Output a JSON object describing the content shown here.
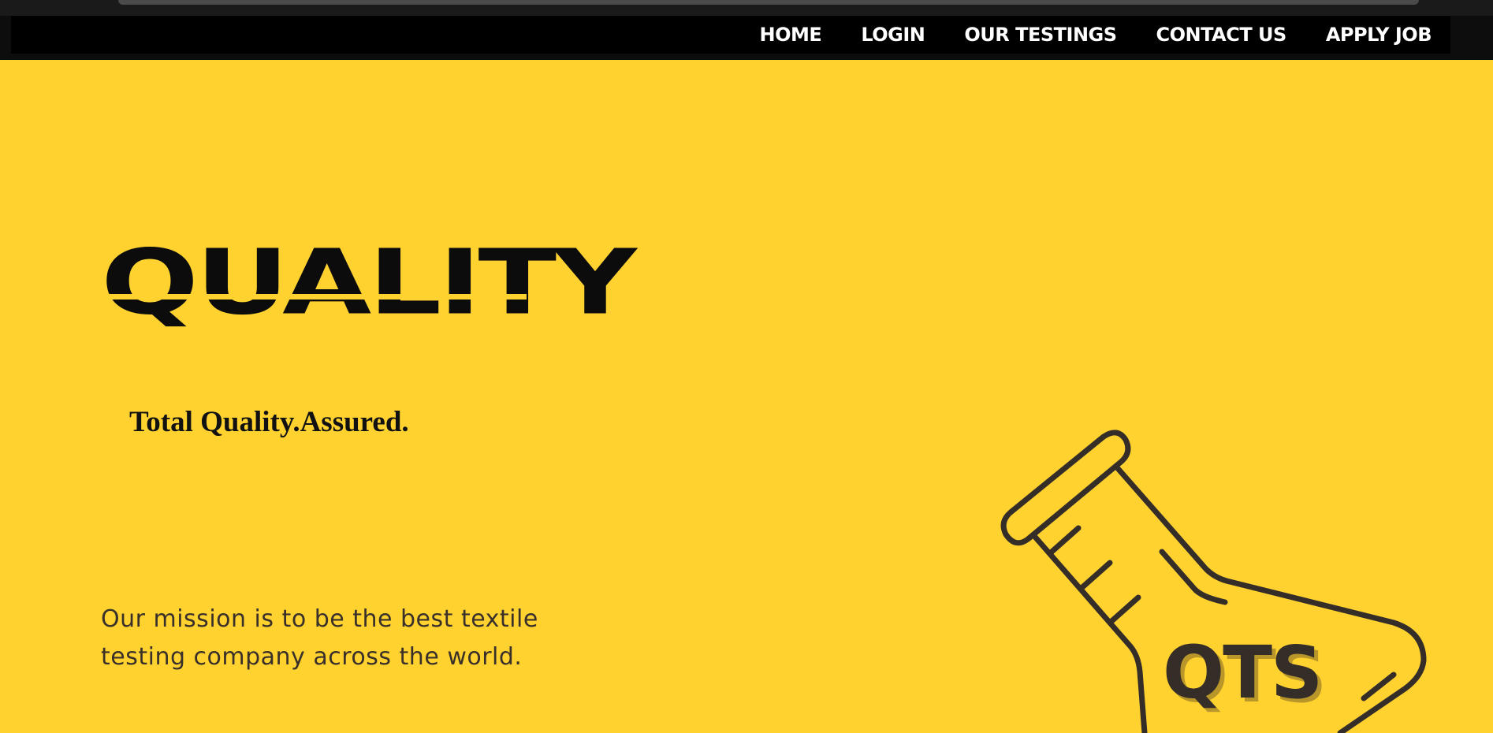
{
  "nav": {
    "items": [
      "HOME",
      "LOGIN",
      "OUR TESTINGS",
      "CONTACT US",
      "APPLY JOB"
    ]
  },
  "hero": {
    "title": "QUALITY",
    "tagline": "Total Quality.Assured.",
    "mission_line1": "Our mission is to be the best textile",
    "mission_line2": "testing company across the world."
  },
  "logo": {
    "text": "QTS",
    "icon": "flask-icon"
  },
  "colors": {
    "background": "#ffd230",
    "navbar": "#000000",
    "nav_text": "#ffffff",
    "title": "#0c0c0c",
    "logo": "#352d27"
  }
}
